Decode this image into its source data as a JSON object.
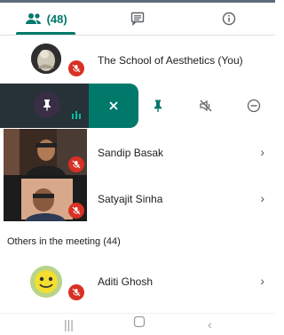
{
  "tabs": {
    "people": {
      "icon": "people-icon",
      "count_label": "(48)"
    },
    "chat": {
      "icon": "chat-icon"
    },
    "info": {
      "icon": "info-icon"
    }
  },
  "participants": {
    "self": {
      "name": "The School of Aesthetics (You)",
      "mic": "mic-off-icon"
    },
    "pinned_actions": {
      "close": "close-icon",
      "pin": "pin-icon",
      "mute": "mute-icon",
      "remove": "remove-icon"
    },
    "list": [
      {
        "name": "Sandip Basak",
        "mic": "mic-off-icon"
      },
      {
        "name": "Satyajit Sinha",
        "mic": "mic-off-icon"
      }
    ]
  },
  "others_section": {
    "label": "Others in the meeting (44)",
    "items": [
      {
        "name": "Aditi Ghosh",
        "mic": "mic-off-icon"
      }
    ]
  },
  "navigation": {
    "recent_apps": "recent-apps-icon",
    "home": "home-icon",
    "back": "back-icon"
  },
  "colors": {
    "accent": "#00796b",
    "mute_red": "#d93025",
    "tile_dark": "#263238"
  }
}
